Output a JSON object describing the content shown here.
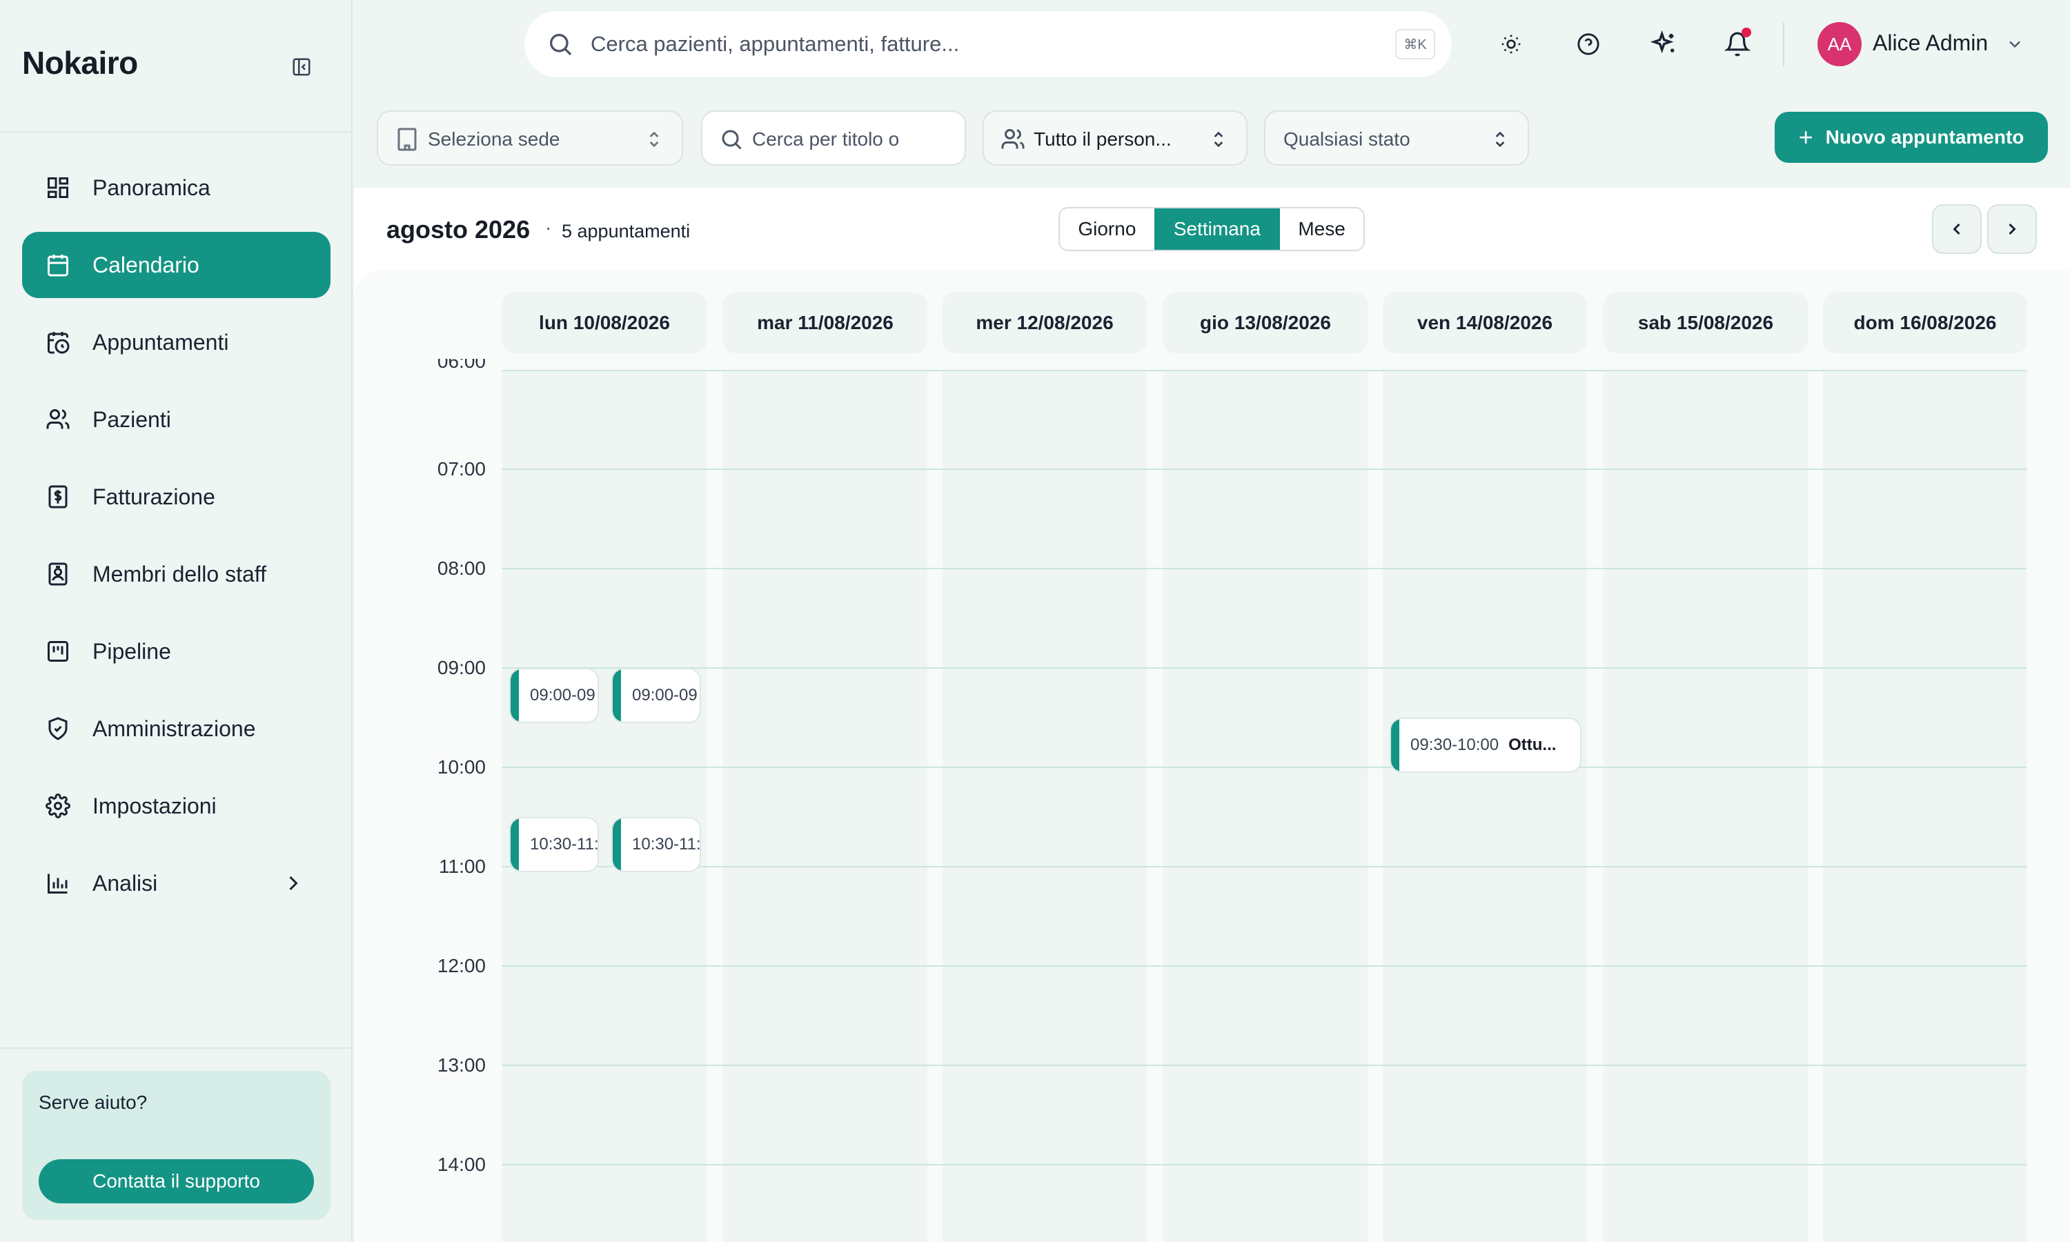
{
  "app": {
    "brand": "Nokairo"
  },
  "sidebar": {
    "items": [
      {
        "label": "Panoramica",
        "icon": "dashboard-icon"
      },
      {
        "label": "Calendario",
        "icon": "calendar-icon"
      },
      {
        "label": "Appuntamenti",
        "icon": "calendar-clock-icon"
      },
      {
        "label": "Pazienti",
        "icon": "users-icon"
      },
      {
        "label": "Fatturazione",
        "icon": "invoice-icon"
      },
      {
        "label": "Membri dello staff",
        "icon": "id-badge-icon"
      },
      {
        "label": "Pipeline",
        "icon": "kanban-icon"
      },
      {
        "label": "Amministrazione",
        "icon": "shield-check-icon"
      },
      {
        "label": "Impostazioni",
        "icon": "gear-icon"
      },
      {
        "label": "Analisi",
        "icon": "bar-chart-icon"
      }
    ],
    "active_index": 1,
    "help": {
      "title": "Serve aiuto?",
      "button": "Contatta il supporto"
    }
  },
  "topbar": {
    "search_placeholder": "Cerca pazienti, appuntamenti, fatture...",
    "shortcut": "⌘K",
    "user": {
      "initials": "AA",
      "name": "Alice Admin"
    }
  },
  "filters": {
    "site": "Seleziona sede",
    "title_search": "Cerca per titolo o",
    "staff": "Tutto il person...",
    "status": "Qualsiasi stato",
    "new_button": "Nuovo appuntamento"
  },
  "calendar": {
    "month": "agosto 2026",
    "separator": "·",
    "count": "5 appuntamenti",
    "views": [
      "Giorno",
      "Settimana",
      "Mese"
    ],
    "active_view": "Settimana",
    "days": [
      "lun 10/08/2026",
      "mar 11/08/2026",
      "mer 12/08/2026",
      "gio 13/08/2026",
      "ven 14/08/2026",
      "sab 15/08/2026",
      "dom 16/08/2026"
    ],
    "hours": [
      "06:00",
      "07:00",
      "08:00",
      "09:00",
      "10:00",
      "11:00",
      "12:00",
      "13:00",
      "14:00"
    ],
    "events": [
      {
        "time": "09:00-09",
        "title": ""
      },
      {
        "time": "09:00-09",
        "title": ""
      },
      {
        "time": "10:30-11:",
        "title": ""
      },
      {
        "time": "10:30-11:",
        "title": ""
      },
      {
        "time": "09:30-10:00",
        "title": "Ottu..."
      }
    ]
  },
  "colors": {
    "accent": "#149484",
    "background": "#eef5f3",
    "notification": "#e11d48",
    "avatar": "#d8336e"
  }
}
